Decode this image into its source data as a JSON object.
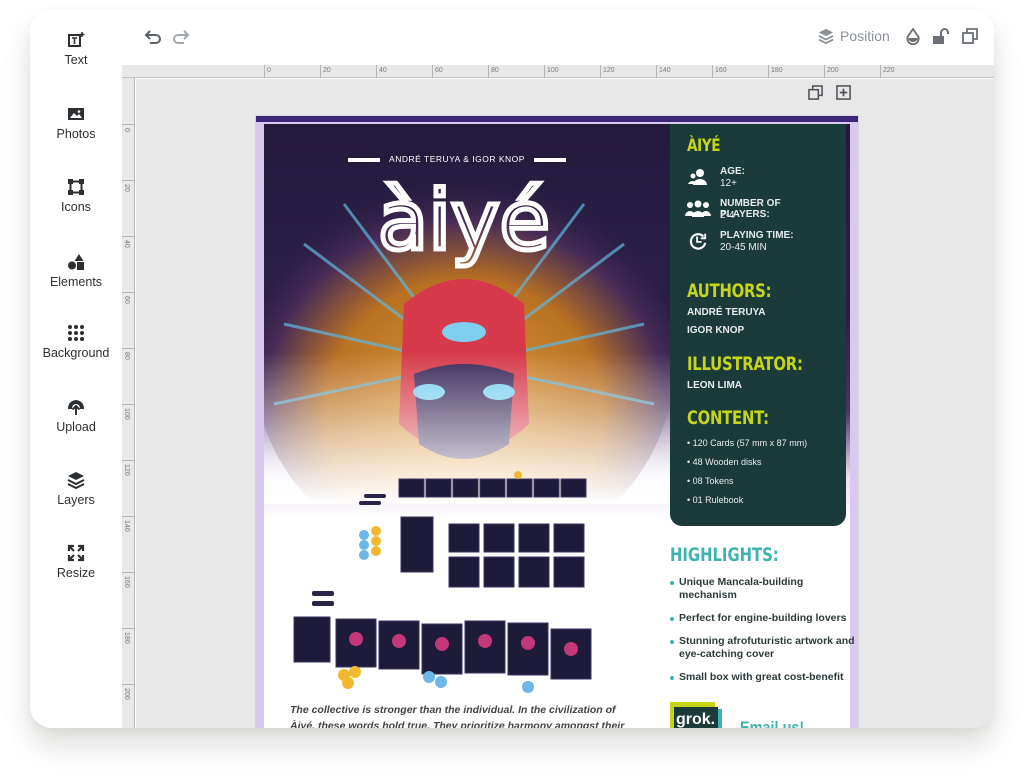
{
  "sidebar": {
    "items": [
      {
        "label": "Text",
        "icon": "text-add-icon"
      },
      {
        "label": "Photos",
        "icon": "photo-icon"
      },
      {
        "label": "Icons",
        "icon": "vector-icon"
      },
      {
        "label": "Elements",
        "icon": "shapes-icon"
      },
      {
        "label": "Background",
        "icon": "dots-grid-icon"
      },
      {
        "label": "Upload",
        "icon": "upload-icon"
      },
      {
        "label": "Layers",
        "icon": "layers-icon"
      },
      {
        "label": "Resize",
        "icon": "resize-icon"
      }
    ]
  },
  "toolbar": {
    "undo_icon": "undo-icon",
    "redo_icon": "redo-icon",
    "position_label": "Position",
    "transparency_icon": "droplet-icon",
    "lock_icon": "unlock-icon",
    "duplicate_icon": "duplicate-icon"
  },
  "rulers": {
    "horizontal": [
      "0",
      "20",
      "40",
      "60",
      "80",
      "100",
      "120",
      "140",
      "160",
      "180",
      "200",
      "220"
    ],
    "vertical": [
      "0",
      "20",
      "40",
      "60",
      "80",
      "100",
      "120",
      "140",
      "160",
      "180",
      "200"
    ]
  },
  "page_tools": {
    "duplicate_page_icon": "duplicate-page-icon",
    "add_page_icon": "add-page-icon"
  },
  "poster": {
    "credit": "ANDRÉ TERUYA & IGOR KNOP",
    "logo_text": "àiyé",
    "info": {
      "title": "ÀIYÉ",
      "stats": [
        {
          "label": "AGE:",
          "value": "12+",
          "icon": "person-icon"
        },
        {
          "label": "NUMBER OF PLAYERS:",
          "value": "2-4",
          "icon": "group-icon"
        },
        {
          "label": "PLAYING TIME:",
          "value": "20-45 MIN",
          "icon": "clock-icon"
        }
      ],
      "authors_heading": "AUTHORS:",
      "authors": [
        "ANDRÉ TERUYA",
        "IGOR KNOP"
      ],
      "illustrator_heading": "ILLUSTRATOR:",
      "illustrator": "LEON LIMA",
      "content_heading": "CONTENT:",
      "content": [
        "• 120 Cards (57 mm x 87 mm)",
        "• 48 Wooden disks",
        "• 08 Tokens",
        "• 01 Rulebook"
      ]
    },
    "highlights": {
      "heading": "HIGHLIGHTS:",
      "items": [
        "Unique Mancala-building mechanism",
        "Perfect for engine-building lovers",
        "Stunning afrofuturistic artwork and eye-catching cover",
        "Small box with great cost-benefit"
      ]
    },
    "quote": "The collective is stronger than the individual. In the civilization of Àiyé, these words hold true. They prioritize harmony amongst their people.",
    "grok_logo": "grok.",
    "email_cta": "Email us!"
  },
  "colors": {
    "accent_lime": "#c6d51a",
    "accent_teal": "#3fb3b0",
    "info_bg": "#1b3b3a",
    "poster_purple": "#3c2578"
  }
}
